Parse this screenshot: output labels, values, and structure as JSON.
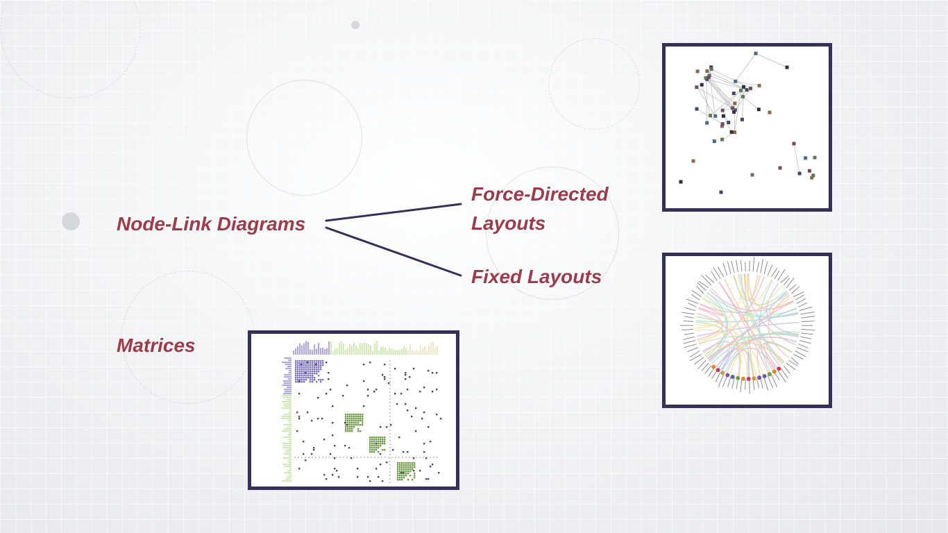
{
  "labels": {
    "node_link": "Node-Link Diagrams",
    "force_directed_line1": "Force-Directed",
    "force_directed_line2": "Layouts",
    "fixed_layouts": "Fixed Layouts",
    "matrices": "Matrices"
  },
  "colors": {
    "label": "#9b3b4b",
    "frame": "#35305a",
    "connector": "#35305a",
    "matrix_purple": "#7b72c4",
    "matrix_green_light": "#b9d88a",
    "matrix_green_dark": "#6f9a4a"
  }
}
